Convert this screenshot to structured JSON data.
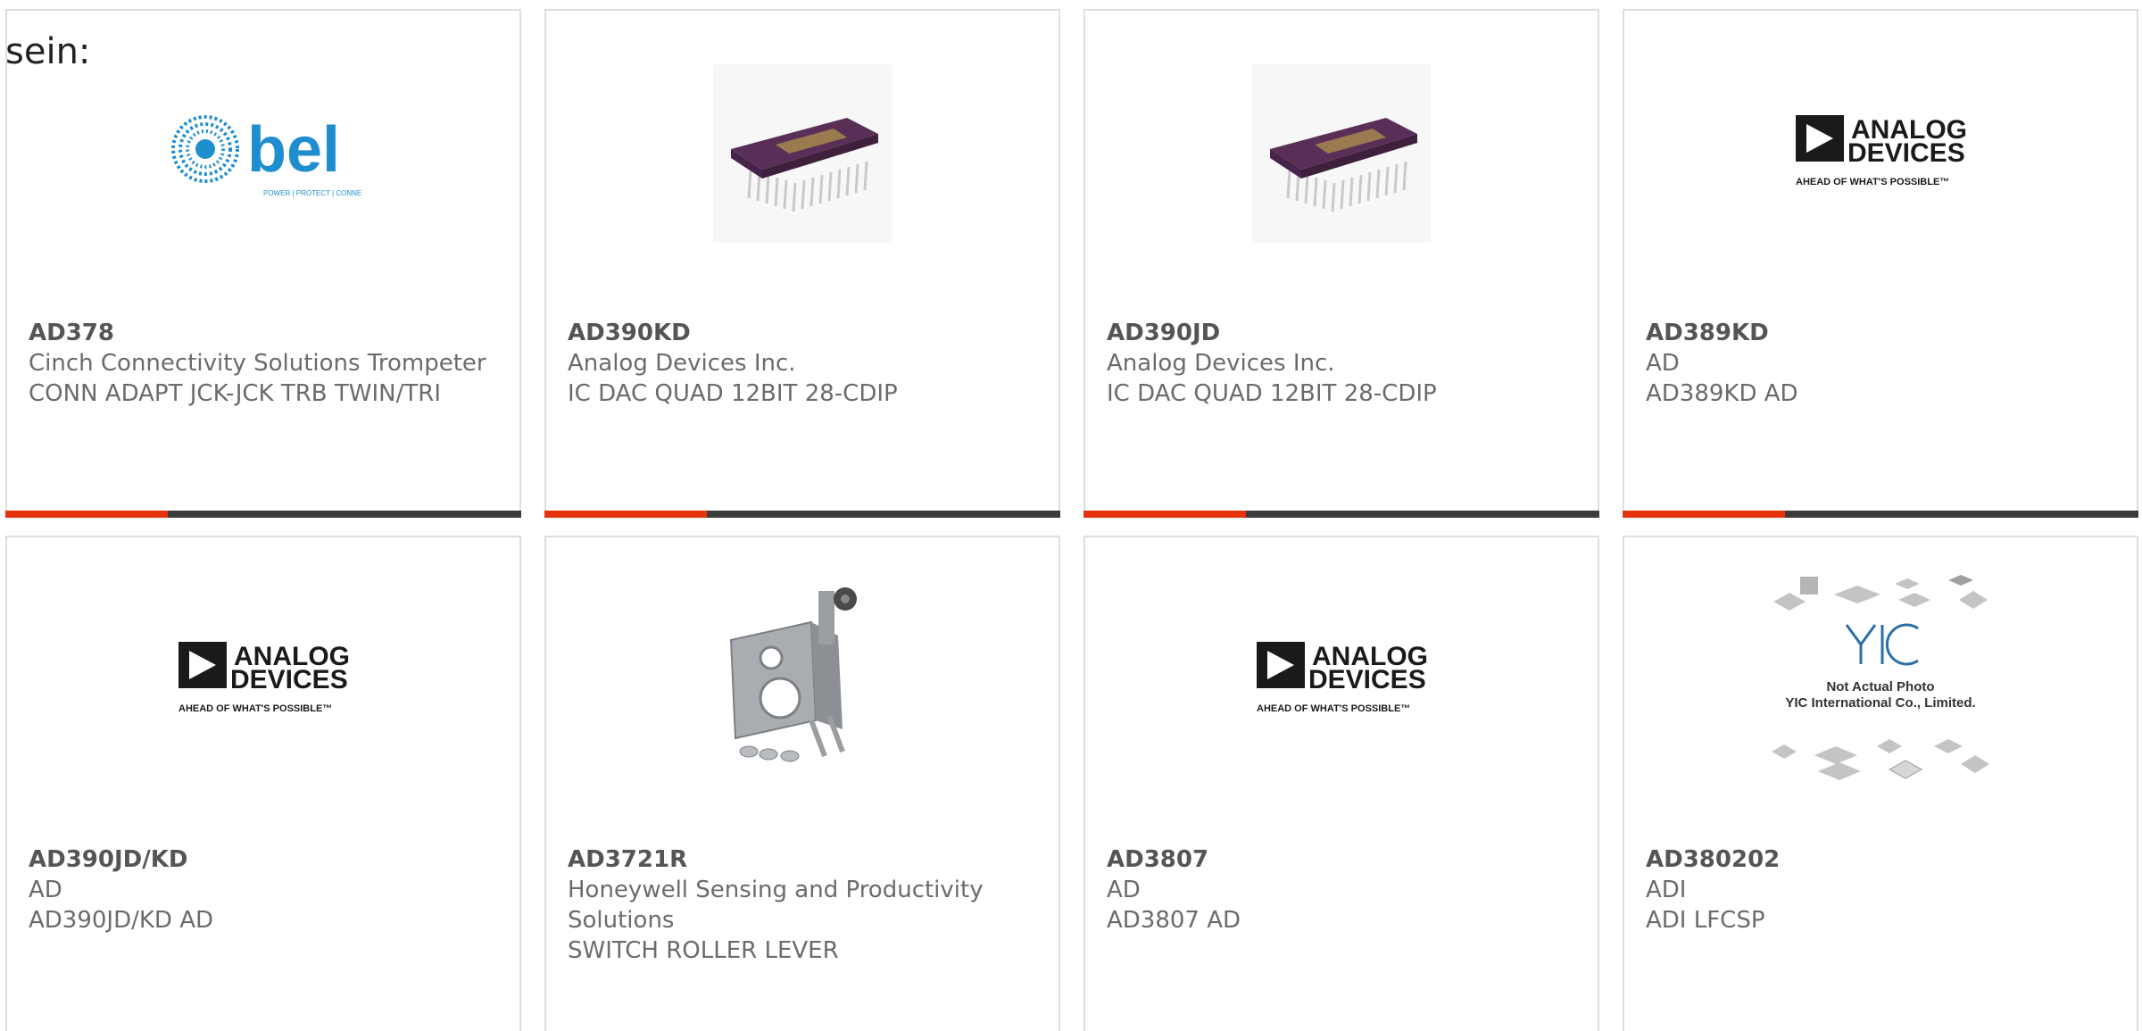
{
  "heading": "sein:",
  "colors": {
    "accent": "#e5330e",
    "bar": "#3c3c3c",
    "border": "#dedede",
    "text": "#6b6b6b",
    "bel_blue": "#1f8ecf",
    "chip_purple": "#5a2f57",
    "chip_gold": "#9a7a4e"
  },
  "products": [
    {
      "part_number": "AD378",
      "manufacturer": "Cinch Connectivity Solutions Trompeter",
      "description": "CONN ADAPT JCK-JCK TRB TWIN/TRI",
      "image": "bel-logo",
      "logo_text": "bel",
      "logo_tagline": "POWER | PROTECT | CONNECT"
    },
    {
      "part_number": "AD390KD",
      "manufacturer": "Analog Devices Inc.",
      "description": "IC DAC QUAD 12BIT 28-CDIP",
      "image": "dip-chip-photo"
    },
    {
      "part_number": "AD390JD",
      "manufacturer": "Analog Devices Inc.",
      "description": "IC DAC QUAD 12BIT 28-CDIP",
      "image": "dip-chip-photo"
    },
    {
      "part_number": "AD389KD",
      "manufacturer": "AD",
      "description": "AD389KD AD",
      "image": "analog-devices-logo",
      "logo_line1": "ANALOG",
      "logo_line2": "DEVICES",
      "logo_tagline": "AHEAD OF WHAT'S POSSIBLE™"
    },
    {
      "part_number": "AD390JD/KD",
      "manufacturer": "AD",
      "description": "AD390JD/KD AD",
      "image": "analog-devices-logo",
      "logo_line1": "ANALOG",
      "logo_line2": "DEVICES",
      "logo_tagline": "AHEAD OF WHAT'S POSSIBLE™"
    },
    {
      "part_number": "AD3721R",
      "manufacturer": "Honeywell Sensing and Productivity Solutions",
      "description": "SWITCH ROLLER LEVER",
      "image": "roller-lever-photo"
    },
    {
      "part_number": "AD3807",
      "manufacturer": "AD",
      "description": "AD3807 AD",
      "image": "analog-devices-logo",
      "logo_line1": "ANALOG",
      "logo_line2": "DEVICES",
      "logo_tagline": "AHEAD OF WHAT'S POSSIBLE™"
    },
    {
      "part_number": "AD380202",
      "manufacturer": "ADI",
      "description": "ADI LFCSP",
      "image": "yic-placeholder",
      "logo_text": "YIC",
      "placeholder_line1": "Not Actual Photo",
      "placeholder_line2": "YIC International Co., Limited."
    }
  ]
}
